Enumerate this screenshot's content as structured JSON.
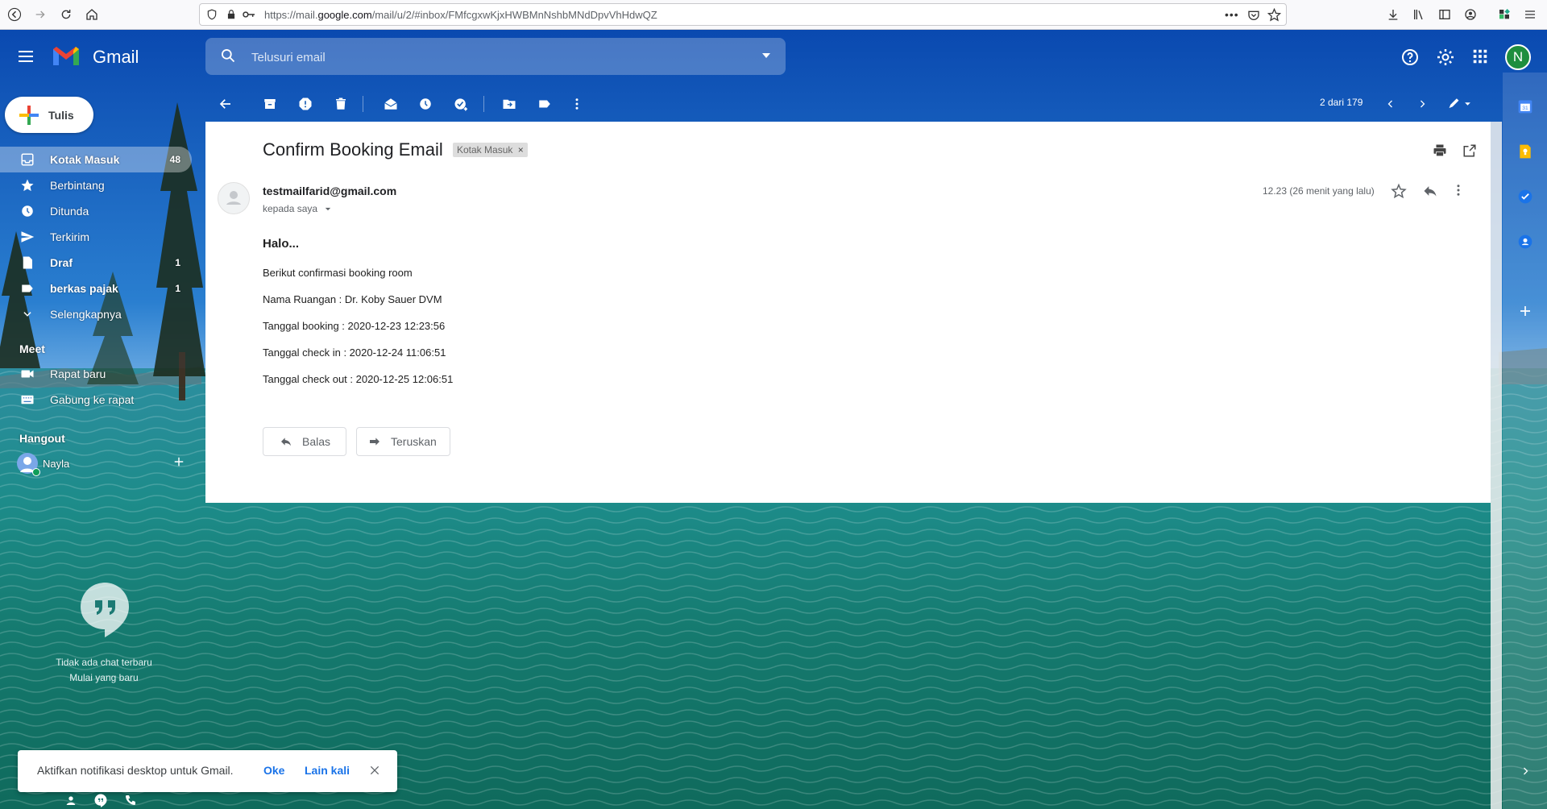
{
  "browser": {
    "url_host_prefix": "https://mail.",
    "url_host": "google.com",
    "url_path": "/mail/u/2/#inbox/FMfcgxwKjxHWBMnNshbMNdDpvVhHdwQZ"
  },
  "header": {
    "app_name": "Gmail",
    "search_placeholder": "Telusuri email",
    "avatar_letter": "N"
  },
  "compose": {
    "label": "Tulis"
  },
  "sidebar": {
    "items": [
      {
        "label": "Kotak Masuk",
        "count": "48",
        "icon": "inbox-icon"
      },
      {
        "label": "Berbintang",
        "count": "",
        "icon": "star-icon"
      },
      {
        "label": "Ditunda",
        "count": "",
        "icon": "clock-icon"
      },
      {
        "label": "Terkirim",
        "count": "",
        "icon": "send-icon"
      },
      {
        "label": "Draf",
        "count": "1",
        "icon": "draft-icon"
      },
      {
        "label": "berkas pajak",
        "count": "1",
        "icon": "label-icon"
      },
      {
        "label": "Selengkapnya",
        "count": "",
        "icon": "chevron-down-icon"
      }
    ],
    "meet_heading": "Meet",
    "meet_items": [
      {
        "label": "Rapat baru",
        "icon": "video-icon"
      },
      {
        "label": "Gabung ke rapat",
        "icon": "keyboard-icon"
      }
    ],
    "hangout_heading": "Hangout",
    "hangout_user": "Nayla",
    "no_chat_line1": "Tidak ada chat terbaru",
    "no_chat_line2": "Mulai yang baru"
  },
  "toolbar": {
    "pagination": "2 dari 179"
  },
  "message": {
    "subject": "Confirm Booking Email",
    "label_chip": "Kotak Masuk",
    "label_close": "×",
    "sender": "testmailfarid@gmail.com",
    "to": "kepada saya",
    "time": "12.23 (26 menit yang lalu)",
    "greeting": "Halo...",
    "lines": [
      "Berikut confirmasi booking room",
      "Nama Ruangan : Dr. Koby Sauer DVM",
      "Tanggal booking : 2020-12-23 12:23:56",
      "Tanggal check in : 2020-12-24 11:06:51",
      "Tanggal check out : 2020-12-25 12:06:51"
    ],
    "reply_label": "Balas",
    "forward_label": "Teruskan"
  },
  "notification": {
    "text": "Aktifkan notifikasi desktop untuk Gmail.",
    "ok": "Oke",
    "later": "Lain kali"
  }
}
